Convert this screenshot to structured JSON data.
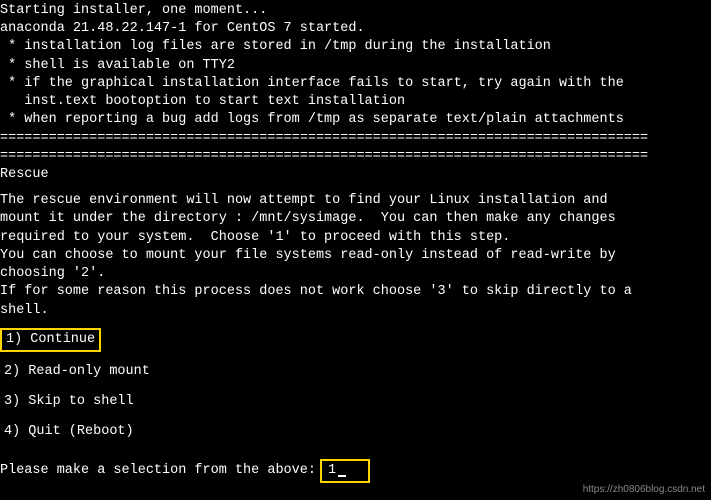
{
  "header": {
    "line1": "Starting installer, one moment...",
    "line2": "anaconda 21.48.22.147-1 for CentOS 7 started.",
    "bullet1": " * installation log files are stored in /tmp during the installation",
    "bullet2": " * shell is available on TTY2",
    "bullet3": " * if the graphical installation interface fails to start, try again with the",
    "bullet3b": "   inst.text bootoption to start text installation",
    "bullet4": " * when reporting a bug add logs from /tmp as separate text/plain attachments"
  },
  "separator1": "================================================================================",
  "separator2": "================================================================================",
  "title": "Rescue",
  "body": {
    "p1a": "The rescue environment will now attempt to find your Linux installation and",
    "p1b": "mount it under the directory : /mnt/sysimage.  You can then make any changes",
    "p1c": "required to your system.  Choose '1' to proceed with this step.",
    "p2a": "You can choose to mount your file systems read-only instead of read-write by",
    "p2b": "choosing '2'.",
    "p3a": "If for some reason this process does not work choose '3' to skip directly to a",
    "p3b": "shell."
  },
  "options": {
    "opt1": "1) Continue",
    "opt2": "2) Read-only mount",
    "opt3": "3) Skip to shell",
    "opt4": "4) Quit (Reboot)"
  },
  "prompt": {
    "label": "Please make a selection from the above:",
    "value": "1"
  },
  "watermark": "https://zh0806blog.csdn.net"
}
